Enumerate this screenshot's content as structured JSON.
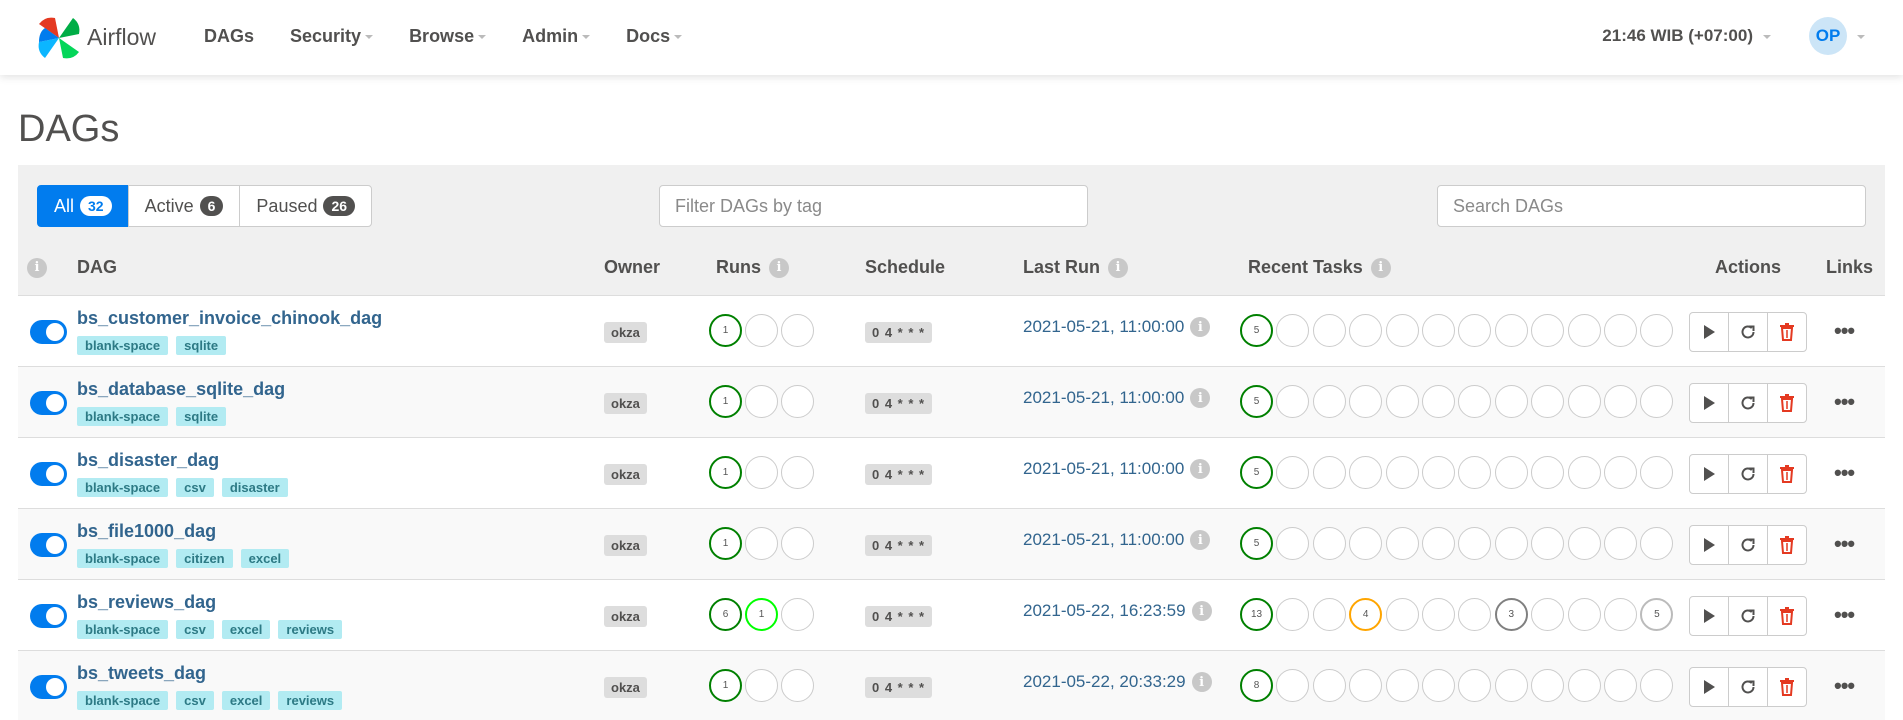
{
  "app": {
    "name": "Airflow"
  },
  "nav": {
    "items": [
      {
        "label": "DAGs",
        "dropdown": false
      },
      {
        "label": "Security",
        "dropdown": true
      },
      {
        "label": "Browse",
        "dropdown": true
      },
      {
        "label": "Admin",
        "dropdown": true
      },
      {
        "label": "Docs",
        "dropdown": true
      }
    ],
    "clock": "21:46 WIB (+07:00)",
    "user_initials": "OP"
  },
  "page": {
    "title": "DAGs"
  },
  "filters": {
    "all": {
      "label": "All",
      "count": "32"
    },
    "active": {
      "label": "Active",
      "count": "6"
    },
    "paused": {
      "label": "Paused",
      "count": "26"
    },
    "tag_placeholder": "Filter DAGs by tag",
    "search_placeholder": "Search DAGs"
  },
  "columns": {
    "dag": "DAG",
    "owner": "Owner",
    "runs": "Runs",
    "schedule": "Schedule",
    "last_run": "Last Run",
    "recent_tasks": "Recent Tasks",
    "actions": "Actions",
    "links": "Links"
  },
  "colors": {
    "success": "#008000",
    "running": "#00ff00",
    "up_for_retry": "#ffa500",
    "queued": "#808080",
    "skipped": "#bbbbbb",
    "accent": "#017cee"
  },
  "dags": [
    {
      "id": "bs_customer_invoice_chinook_dag",
      "tags": [
        "blank-space",
        "sqlite"
      ],
      "owner": "okza",
      "runs": [
        {
          "state": "success",
          "count": "1"
        },
        {
          "state": "none",
          "count": ""
        },
        {
          "state": "none",
          "count": ""
        }
      ],
      "schedule": "0 4 * * *",
      "last_run": "2021-05-21, 11:00:00",
      "tasks": [
        {
          "state": "success",
          "count": "5"
        },
        {},
        {},
        {},
        {},
        {},
        {},
        {},
        {},
        {},
        {},
        {}
      ]
    },
    {
      "id": "bs_database_sqlite_dag",
      "tags": [
        "blank-space",
        "sqlite"
      ],
      "owner": "okza",
      "runs": [
        {
          "state": "success",
          "count": "1"
        },
        {
          "state": "none",
          "count": ""
        },
        {
          "state": "none",
          "count": ""
        }
      ],
      "schedule": "0 4 * * *",
      "last_run": "2021-05-21, 11:00:00",
      "tasks": [
        {
          "state": "success",
          "count": "5"
        },
        {},
        {},
        {},
        {},
        {},
        {},
        {},
        {},
        {},
        {},
        {}
      ]
    },
    {
      "id": "bs_disaster_dag",
      "tags": [
        "blank-space",
        "csv",
        "disaster"
      ],
      "owner": "okza",
      "runs": [
        {
          "state": "success",
          "count": "1"
        },
        {
          "state": "none",
          "count": ""
        },
        {
          "state": "none",
          "count": ""
        }
      ],
      "schedule": "0 4 * * *",
      "last_run": "2021-05-21, 11:00:00",
      "tasks": [
        {
          "state": "success",
          "count": "5"
        },
        {},
        {},
        {},
        {},
        {},
        {},
        {},
        {},
        {},
        {},
        {}
      ]
    },
    {
      "id": "bs_file1000_dag",
      "tags": [
        "blank-space",
        "citizen",
        "excel"
      ],
      "owner": "okza",
      "runs": [
        {
          "state": "success",
          "count": "1"
        },
        {
          "state": "none",
          "count": ""
        },
        {
          "state": "none",
          "count": ""
        }
      ],
      "schedule": "0 4 * * *",
      "last_run": "2021-05-21, 11:00:00",
      "tasks": [
        {
          "state": "success",
          "count": "5"
        },
        {},
        {},
        {},
        {},
        {},
        {},
        {},
        {},
        {},
        {},
        {}
      ]
    },
    {
      "id": "bs_reviews_dag",
      "tags": [
        "blank-space",
        "csv",
        "excel",
        "reviews"
      ],
      "owner": "okza",
      "runs": [
        {
          "state": "success",
          "count": "6"
        },
        {
          "state": "running",
          "count": "1"
        },
        {
          "state": "none",
          "count": ""
        }
      ],
      "schedule": "0 4 * * *",
      "last_run": "2021-05-22, 16:23:59",
      "tasks": [
        {
          "state": "success",
          "count": "13"
        },
        {},
        {},
        {
          "state": "retry",
          "count": "4"
        },
        {},
        {},
        {},
        {
          "state": "queued",
          "count": "3"
        },
        {},
        {},
        {},
        {
          "state": "skipped",
          "count": "5"
        }
      ]
    },
    {
      "id": "bs_tweets_dag",
      "tags": [
        "blank-space",
        "csv",
        "excel",
        "reviews"
      ],
      "owner": "okza",
      "runs": [
        {
          "state": "success",
          "count": "1"
        },
        {
          "state": "none",
          "count": ""
        },
        {
          "state": "none",
          "count": ""
        }
      ],
      "schedule": "0 4 * * *",
      "last_run": "2021-05-22, 20:33:29",
      "tasks": [
        {
          "state": "success",
          "count": "8"
        },
        {},
        {},
        {},
        {},
        {},
        {},
        {},
        {},
        {},
        {},
        {}
      ]
    }
  ]
}
